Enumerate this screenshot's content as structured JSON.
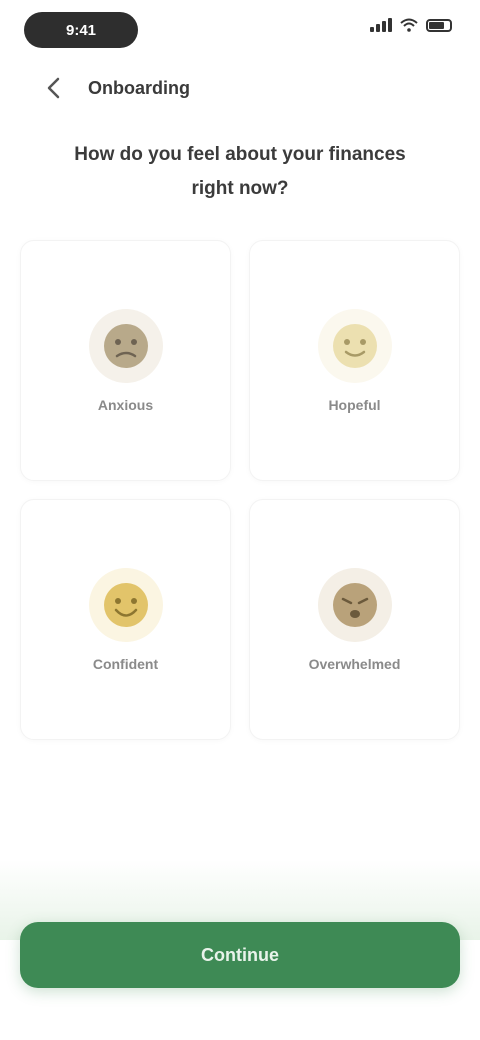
{
  "status_bar": {
    "time": "9:41"
  },
  "header": {
    "title": "Onboarding"
  },
  "question": {
    "line1": "How do you feel about your finances",
    "line2": "right now?"
  },
  "options": [
    {
      "label": "Anxious",
      "icon": "face-anxious-icon",
      "color": "#b8a98a",
      "bg": "#f5f1ea"
    },
    {
      "label": "Hopeful",
      "icon": "face-hopeful-icon",
      "color": "#e8d9a0",
      "bg": "#fbf8ee"
    },
    {
      "label": "Confident",
      "icon": "face-confident-icon",
      "color": "#e2c46a",
      "bg": "#fbf5e2"
    },
    {
      "label": "Overwhelmed",
      "icon": "face-overwhelmed-icon",
      "color": "#b9a27a",
      "bg": "#f4efe6"
    }
  ],
  "cta": {
    "label": "Continue"
  },
  "colors": {
    "accent": "#3e8a55"
  }
}
